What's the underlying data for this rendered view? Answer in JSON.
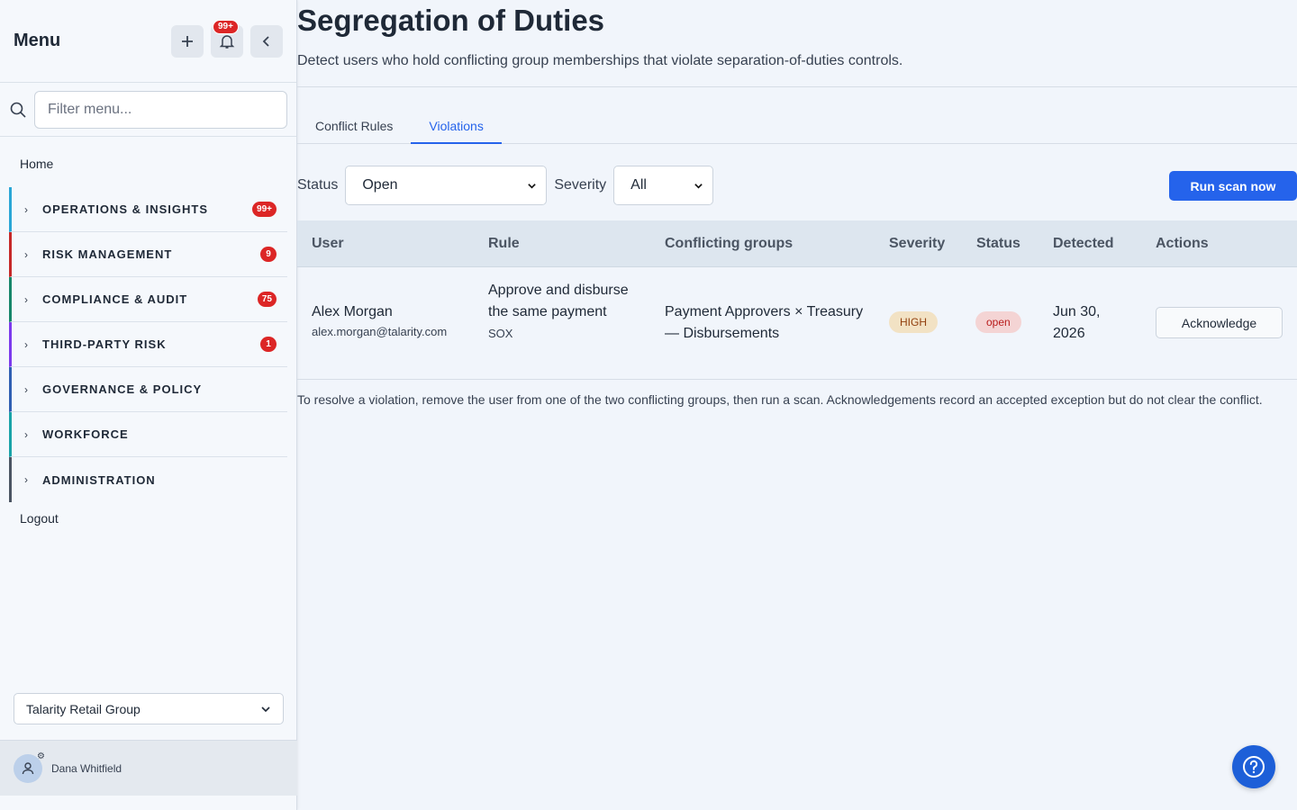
{
  "sidebar": {
    "title": "Menu",
    "notif_badge": "99+",
    "filter_placeholder": "Filter menu...",
    "home": "Home",
    "items": [
      {
        "label": "OPERATIONS & INSIGHTS",
        "badge": "99+",
        "color": "#2aa6d6"
      },
      {
        "label": "RISK MANAGEMENT",
        "badge": "9",
        "color": "#c62828"
      },
      {
        "label": "COMPLIANCE & AUDIT",
        "badge": "75",
        "color": "#16866a"
      },
      {
        "label": "THIRD-PARTY RISK",
        "badge": "1",
        "color": "#7c3aed"
      },
      {
        "label": "GOVERNANCE & POLICY",
        "badge": "",
        "color": "#2f5fb3"
      },
      {
        "label": "WORKFORCE",
        "badge": "",
        "color": "#19a3a8"
      },
      {
        "label": "ADMINISTRATION",
        "badge": "",
        "color": "#4b5563"
      }
    ],
    "logout": "Logout",
    "org": "Talarity Retail Group",
    "user_name": "Dana Whitfield"
  },
  "page": {
    "title": "Segregation of Duties",
    "subtitle": "Detect users who hold conflicting group memberships that violate separation-of-duties controls."
  },
  "tabs": [
    {
      "label": "Conflict Rules",
      "active": false
    },
    {
      "label": "Violations",
      "active": true
    }
  ],
  "filters": {
    "status_label": "Status",
    "status_value": "Open",
    "severity_label": "Severity",
    "severity_value": "All"
  },
  "run_scan_label": "Run scan now",
  "table": {
    "headers": [
      "User",
      "Rule",
      "Conflicting groups",
      "Severity",
      "Status",
      "Detected",
      "Actions"
    ],
    "rows": [
      {
        "user_name": "Alex Morgan",
        "user_email": "alex.morgan@talarity.com",
        "rule": "Approve and disburse the same payment",
        "rule_framework": "SOX",
        "groups": "Payment Approvers × Treasury — Disbursements",
        "severity": "HIGH",
        "status": "open",
        "detected": "Jun 30, 2026",
        "action": "Acknowledge"
      }
    ]
  },
  "note": "To resolve a violation, remove the user from one of the two conflicting groups, then run a scan. Acknowledgements record an accepted exception but do not clear the conflict.",
  "colors": {
    "accent": "#2563eb",
    "badge": "#dc2626"
  }
}
